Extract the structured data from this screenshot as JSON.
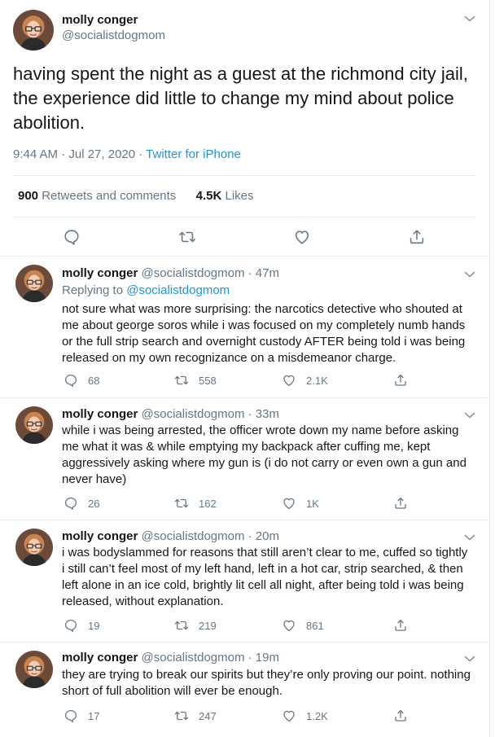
{
  "main_tweet": {
    "author_name": "molly conger",
    "author_handle": "@socialistdogmom",
    "text": "having spent the night as a guest at the richmond city jail, the experience did little to change my mind about police abolition.",
    "time": "9:44 AM · Jul 27, 2020 · ",
    "source": "Twitter for iPhone",
    "retweets_count": "900",
    "retweets_label": " Retweets and comments",
    "likes_count": "4.5K",
    "likes_label": " Likes",
    "action_icons": [
      "reply-icon",
      "retweet-icon",
      "like-icon",
      "share-icon"
    ]
  },
  "replies": [
    {
      "author_name": "molly conger",
      "author_handle": "@socialistdogmom",
      "age": " · 47m",
      "replying_label": "Replying to ",
      "replying_handle": "@socialistdogmom",
      "text": "not sure what was more surprising: the narcotics detective who shouted at me about george soros while i was focused on my completely numb hands or the full strip search and overnight custody AFTER being told i was being released on my own recognizance on a misdemeanor charge.",
      "replies": "68",
      "retweets": "558",
      "likes": "2.1K"
    },
    {
      "author_name": "molly conger",
      "author_handle": "@socialistdogmom",
      "age": " · 33m",
      "text": "while i was being arrested, the officer wrote down my name before asking me what it was & while emptying my backpack after cuffing me, kept aggressively asking where my gun is (i do not carry or even own a gun and never have)",
      "replies": "26",
      "retweets": "162",
      "likes": "1K"
    },
    {
      "author_name": "molly conger",
      "author_handle": "@socialistdogmom",
      "age": " · 20m",
      "text": "i was bodyslammed for reasons that still aren’t clear to me, cuffed so tightly i still can’t feel most of my left hand, left in a hot car, strip searched, & then left alone in an ice cold, brightly lit cell all night, after being told i was being released, without explanation.",
      "replies": "19",
      "retweets": "219",
      "likes": "861"
    },
    {
      "author_name": "molly conger",
      "author_handle": "@socialistdogmom",
      "age": " · 19m",
      "text": "they are trying to break our spirits but they’re only proving our point. nothing short of full abolition will ever be enough.",
      "replies": "17",
      "retweets": "247",
      "likes": "1.2K"
    }
  ],
  "colors": {
    "link": "#1b95e0",
    "muted": "#657786",
    "text": "#14171a",
    "divider": "#e6ecf0"
  }
}
